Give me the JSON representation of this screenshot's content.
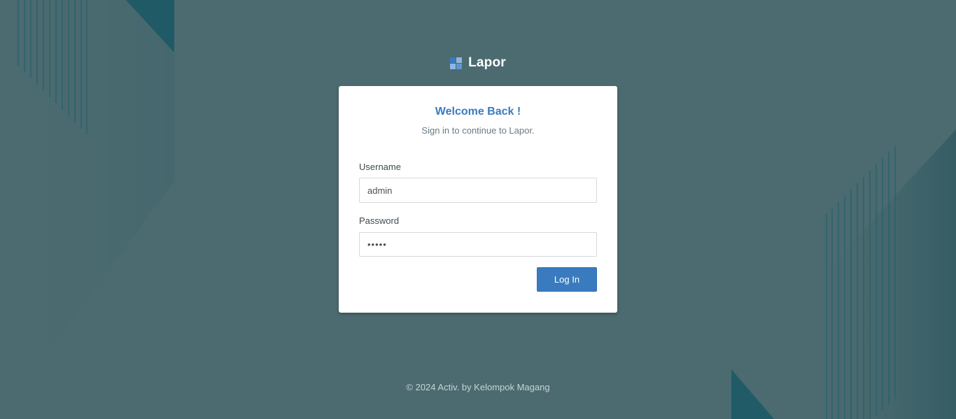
{
  "brand": {
    "name": "Lapor",
    "logo_icon": "grid-logo-icon"
  },
  "login_card": {
    "title": "Welcome Back !",
    "subtitle": "Sign in to continue to Lapor.",
    "username": {
      "label": "Username",
      "value": "admin"
    },
    "password": {
      "label": "Password",
      "value": "admin"
    },
    "submit_label": "Log In"
  },
  "footer": {
    "text": "© 2024 Activ. by Kelompok Magang"
  },
  "colors": {
    "background": "#4b6b70",
    "accent": "#3a7bbf",
    "decor_dark": "#245a66"
  }
}
